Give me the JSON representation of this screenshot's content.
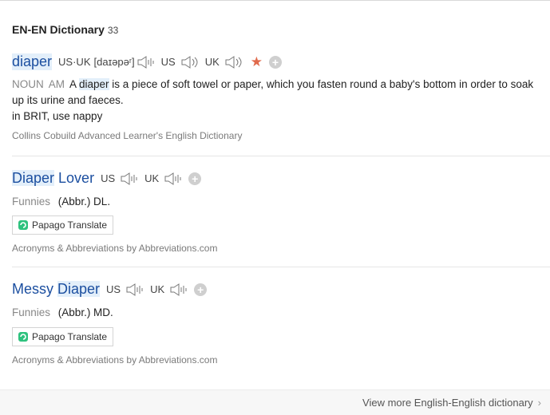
{
  "section": {
    "title": "EN-EN Dictionary",
    "count": "33"
  },
  "entries": [
    {
      "word_hl": "diaper",
      "pron_both_label": "US·UK",
      "phonetic": "[dаɪəpəʳ]",
      "us_label": "US",
      "uk_label": "UK",
      "pos1": "NOUN",
      "pos2": "AM",
      "def_a": "A ",
      "def_hl": "diaper",
      "def_b": " is a piece of soft towel or paper, which you fasten round a baby's bottom in order to soak up its urine and faeces.",
      "note": "in BRIT, use nappy",
      "source": "Collins Cobuild Advanced Learner's English Dictionary"
    },
    {
      "word_hl": "Diaper",
      "word_rest": " Lover",
      "us_label": "US",
      "uk_label": "UK",
      "category": "Funnies",
      "abbr": "(Abbr.) DL.",
      "papago_label": "Papago Translate",
      "source": "Acronyms & Abbreviations by Abbreviations.com"
    },
    {
      "word_pre": "Messy ",
      "word_hl": "Diaper",
      "us_label": "US",
      "uk_label": "UK",
      "category": "Funnies",
      "abbr": "(Abbr.) MD.",
      "papago_label": "Papago Translate",
      "source": "Acronyms & Abbreviations by Abbreviations.com"
    }
  ],
  "footer": {
    "more_label": "View more English-English dictionary"
  },
  "colors": {
    "link": "#1c4fa0",
    "highlight": "#e3effa",
    "star": "#e06a4c"
  },
  "icons": [
    "speaker-icon",
    "star-icon",
    "plus-icon",
    "papago-icon",
    "chevron-right-icon"
  ]
}
